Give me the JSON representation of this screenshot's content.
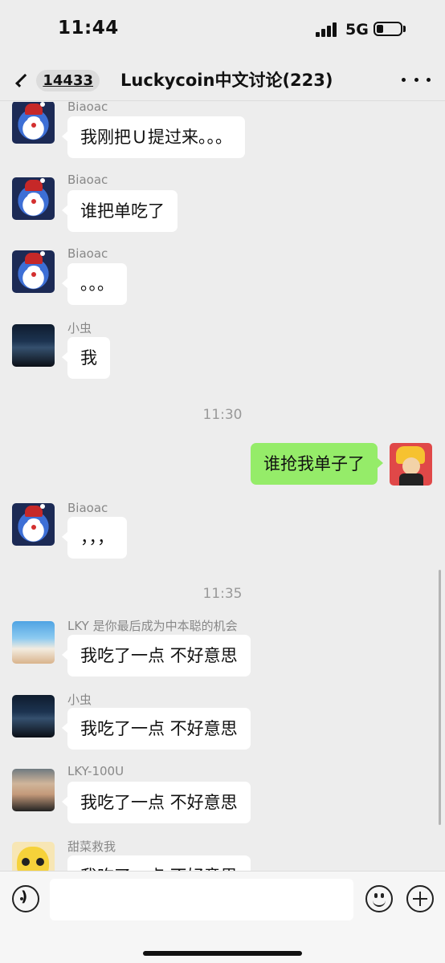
{
  "status_bar": {
    "time": "11:44",
    "network": "5G"
  },
  "nav": {
    "unread_count": "14433",
    "title": "Luckycoin中文讨论(223)"
  },
  "messages": [
    {
      "sender": "Biaoac",
      "text": "我刚把Ｕ提过来。。。",
      "avatar": "doraemon-avatar"
    },
    {
      "sender": "Biaoac",
      "text": "谁把单吃了",
      "avatar": "doraemon-avatar"
    },
    {
      "sender": "Biaoac",
      "text": "。。。",
      "avatar": "doraemon-avatar"
    },
    {
      "sender": "小虫",
      "text": "我",
      "avatar": "night-scene-avatar"
    },
    {
      "timestamp": "11:30"
    },
    {
      "sender": "me",
      "text": "谁抢我单子了",
      "avatar": "naruto-avatar",
      "mine": true
    },
    {
      "sender": "Biaoac",
      "text": "，，，",
      "avatar": "doraemon-avatar"
    },
    {
      "timestamp": "11:35"
    },
    {
      "sender": "LKY 是你最后成为中本聪的机会",
      "text": "我吃了一点 不好意思",
      "avatar": "beach-avatar"
    },
    {
      "sender": "小虫",
      "text": "我吃了一点 不好意思",
      "avatar": "night-scene-avatar"
    },
    {
      "sender": "LKY-100U",
      "text": "我吃了一点 不好意思",
      "avatar": "person-avatar"
    },
    {
      "sender": "甜菜救我",
      "text": "我吃了一点 不好意思",
      "avatar": "pikachu-avatar"
    }
  ],
  "input": {
    "value": "",
    "placeholder": ""
  },
  "colors": {
    "background": "#ededed",
    "my_bubble": "#95ec69",
    "their_bubble": "#ffffff"
  }
}
